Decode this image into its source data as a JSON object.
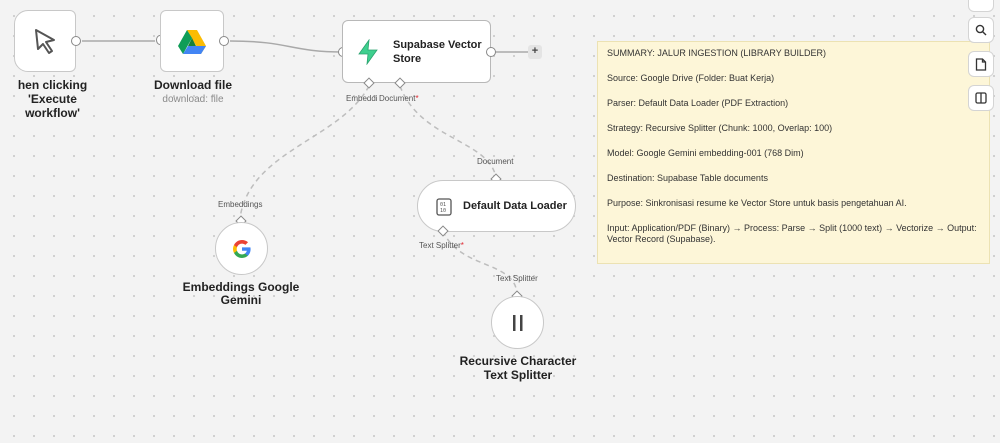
{
  "nodes": {
    "trigger": {
      "title": "hen clicking 'Execute workflow'"
    },
    "download": {
      "title": "Download file",
      "subtitle": "download: file"
    },
    "supabase": {
      "title_line1": "Supabase Vector",
      "title_line2": "Store",
      "port_embedding": "Embeddi",
      "port_document": "Document",
      "required_mark": "*"
    },
    "embeddings": {
      "title_line1": "Embeddings Google",
      "title_line2": "Gemini",
      "port_label": "Embeddings"
    },
    "loader": {
      "title": "Default Data Loader",
      "port_in_label": "Document",
      "port_text_splitter": "Text Splitter",
      "required_mark": "*"
    },
    "splitter": {
      "title_line1": "Recursive Character",
      "title_line2": "Text Splitter",
      "port_label": "Text Splitter"
    }
  },
  "plus_button": "+",
  "sticky_note": {
    "lines": [
      "SUMMARY: JALUR INGESTION (LIBRARY BUILDER)",
      "Source: Google Drive (Folder: Buat Kerja)",
      "Parser: Default Data Loader (PDF Extraction)",
      "Strategy: Recursive Splitter (Chunk: 1000, Overlap: 100)",
      "Model: Google Gemini embedding-001 (768 Dim)",
      "Destination: Supabase Table documents",
      "Purpose: Sinkronisasi resume ke Vector Store untuk basis pengetahuan AI.",
      "Input: Application/PDF (Binary) → Process: Parse → Split (1000 text) → Vectorize → Output: Vector Record (Supabase)."
    ]
  },
  "toolbar": {
    "icons": [
      "partial-button-icon",
      "search-icon",
      "sticky-note-icon",
      "panel-toggle-icon"
    ]
  }
}
